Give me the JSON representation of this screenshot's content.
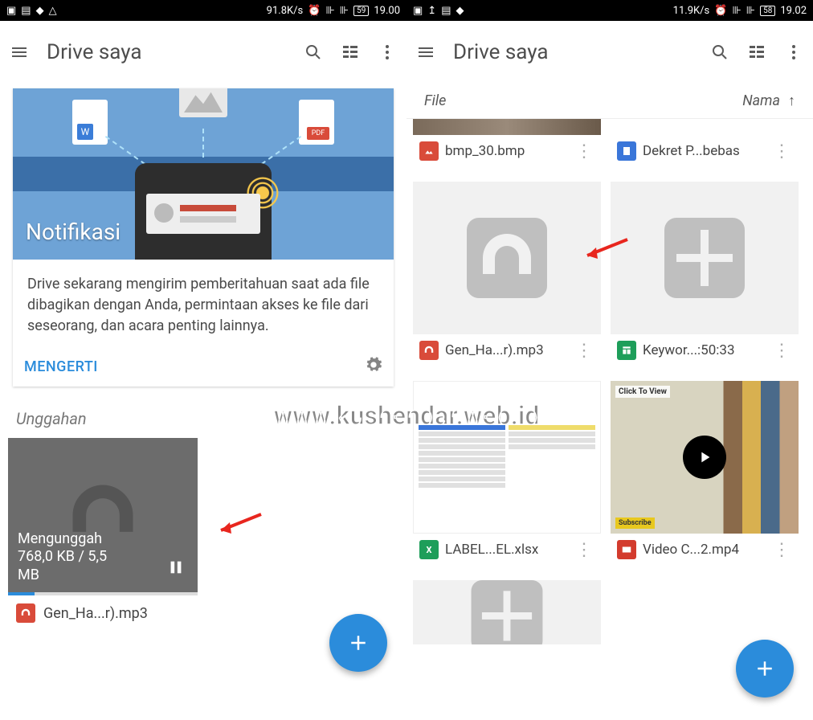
{
  "watermark": "www.kushendar.web.id",
  "left": {
    "status": {
      "speed": "91.8K/s",
      "battery": "59",
      "time": "19.00"
    },
    "title": "Drive saya",
    "card": {
      "hero_title": "Notifikasi",
      "body": "Drive sekarang mengirim pemberitahuan saat ada file dibagikan dengan Anda, permintaan akses ke file dari seseorang, dan acara penting lainnya.",
      "action": "MENGERTI"
    },
    "uploads_label": "Unggahan",
    "upload": {
      "line1": "Mengunggah",
      "line2": "768,0 KB / 5,5",
      "line3": "MB",
      "caption": "Gen_Ha...r).mp3"
    }
  },
  "right": {
    "status": {
      "speed": "11.9K/s",
      "battery": "58",
      "time": "19.02"
    },
    "title": "Drive saya",
    "sort": {
      "file": "File",
      "name": "Nama"
    },
    "files": [
      {
        "name": "bmp_30.bmp",
        "icon": "image"
      },
      {
        "name": "Dekret P...bebas",
        "icon": "doc"
      },
      {
        "name": "Gen_Ha...r).mp3",
        "icon": "audio"
      },
      {
        "name": "Keywor...:50:33",
        "icon": "sheet"
      },
      {
        "name": "LABEL...EL.xlsx",
        "icon": "xls"
      },
      {
        "name": "Video C...2.mp4",
        "icon": "video"
      }
    ]
  }
}
